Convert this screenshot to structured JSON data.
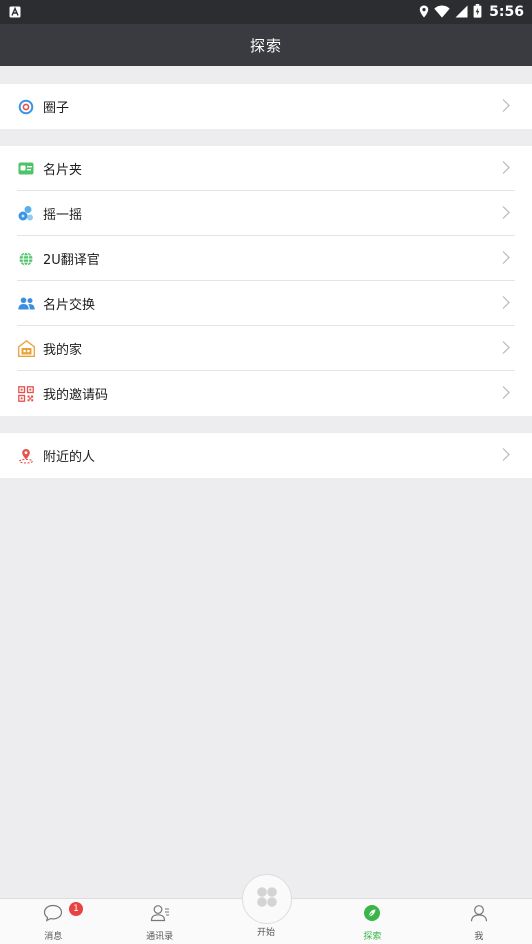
{
  "status_bar": {
    "time": "5:56"
  },
  "header": {
    "title": "探索"
  },
  "groups": [
    {
      "items": [
        {
          "label": "圈子",
          "icon": "circle-target-icon"
        }
      ]
    },
    {
      "items": [
        {
          "label": "名片夹",
          "icon": "card-holder-icon"
        },
        {
          "label": "摇一摇",
          "icon": "shake-icon"
        },
        {
          "label": "2U翻译官",
          "icon": "translate-globe-icon"
        },
        {
          "label": "名片交换",
          "icon": "people-exchange-icon"
        },
        {
          "label": "我的家",
          "icon": "home-icon"
        },
        {
          "label": "我的邀请码",
          "icon": "qr-code-icon"
        }
      ]
    },
    {
      "items": [
        {
          "label": "附近的人",
          "icon": "location-pin-icon"
        }
      ]
    }
  ],
  "tabbar": {
    "tabs": [
      {
        "label": "消息",
        "icon": "chat-bubble-icon",
        "badge": "1"
      },
      {
        "label": "通讯录",
        "icon": "contacts-icon"
      },
      {
        "label": "开始",
        "icon": "start-grid-icon"
      },
      {
        "label": "探索",
        "icon": "explore-compass-icon",
        "active": true
      },
      {
        "label": "我",
        "icon": "user-icon"
      }
    ]
  },
  "colors": {
    "accent_green": "#3bb54a",
    "badge_red": "#e84343",
    "header_bg": "#3a3b40"
  }
}
